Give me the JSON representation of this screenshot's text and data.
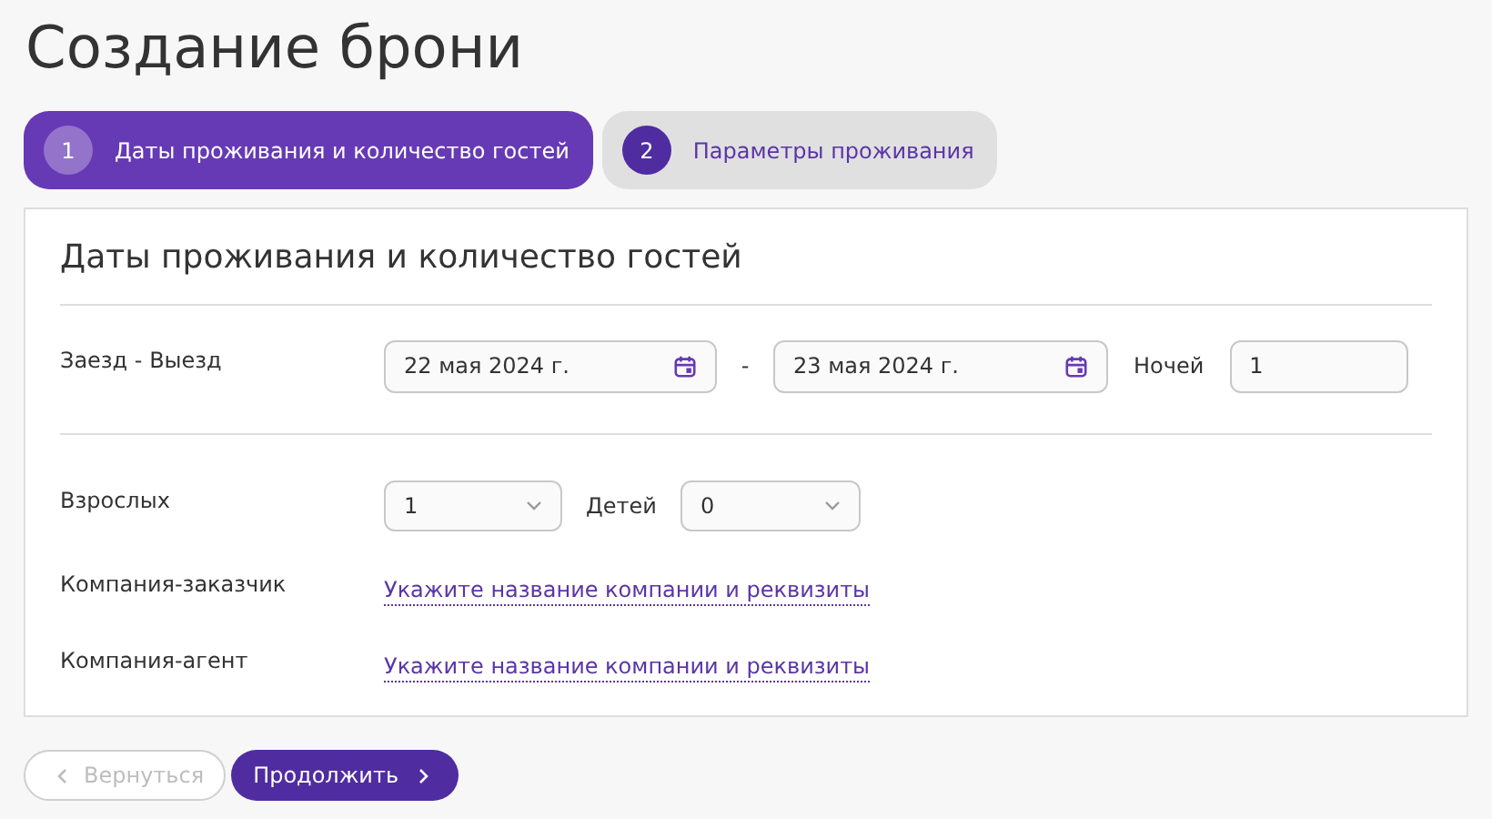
{
  "title": "Создание брони",
  "steps": [
    {
      "number": "1",
      "label": "Даты проживания и количество гостей",
      "selected": true
    },
    {
      "number": "2",
      "label": "Параметры проживания",
      "selected": false
    }
  ],
  "card": {
    "title": "Даты проживания и количество гостей",
    "dates": {
      "label": "Заезд - Выезд",
      "check_in": "22 мая 2024 г.",
      "separator": "-",
      "check_out": "23 мая 2024 г.",
      "nights_label": "Ночей",
      "nights": "1"
    },
    "adults": {
      "label": "Взрослых",
      "value": "1"
    },
    "children": {
      "label": "Детей",
      "value": "0"
    },
    "companies": [
      {
        "label": "Компания-заказчик",
        "link": "Укажите название компании и реквизиты"
      },
      {
        "label": "Компания-агент",
        "link": "Укажите название компании и реквизиты"
      }
    ]
  },
  "buttons": [
    {
      "kind": "back",
      "label": "Вернуться",
      "disabled": true
    },
    {
      "kind": "next",
      "label": "Продолжить",
      "disabled": false
    }
  ]
}
